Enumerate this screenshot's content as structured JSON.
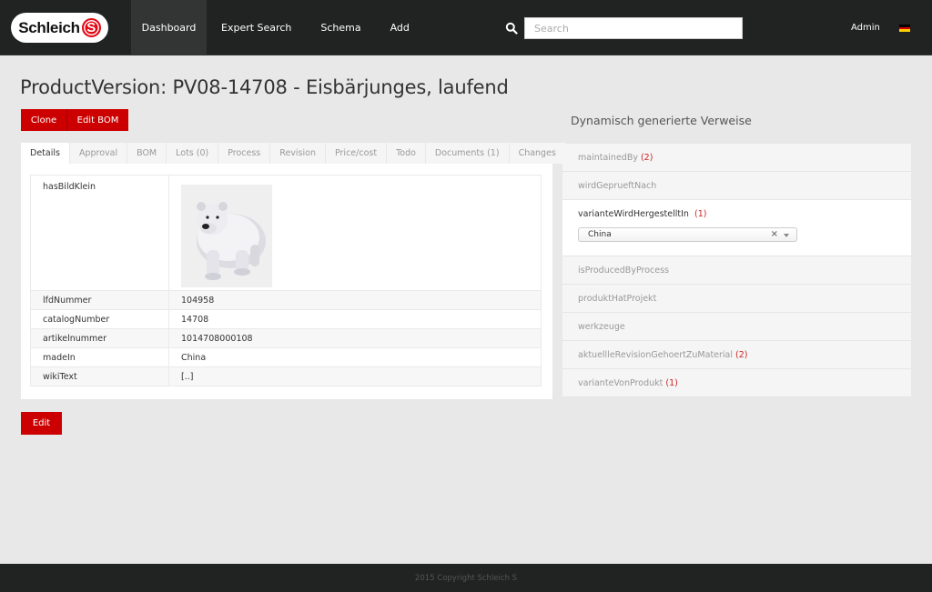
{
  "header": {
    "logo_text": "Schleich",
    "logo_mark": "S",
    "nav": [
      {
        "label": "Dashboard",
        "active": true
      },
      {
        "label": "Expert Search",
        "active": false
      },
      {
        "label": "Schema",
        "active": false
      },
      {
        "label": "Add",
        "active": false
      }
    ],
    "search": {
      "placeholder": "Search",
      "value": "",
      "icon": "search-icon"
    },
    "user": "Admin",
    "language_flag": "flag-de-icon",
    "flag_colors": [
      "#000000",
      "#dd0000",
      "#ffce00"
    ]
  },
  "page": {
    "title": "ProductVersion: PV08-14708 - Eisbärjunges, laufend",
    "actions": {
      "clone": "Clone",
      "edit_bom": "Edit BOM",
      "edit": "Edit"
    },
    "tabs": [
      {
        "label": "Details",
        "active": true
      },
      {
        "label": "Approval",
        "active": false
      },
      {
        "label": "BOM",
        "active": false
      },
      {
        "label": "Lots (0)",
        "active": false
      },
      {
        "label": "Process",
        "active": false
      },
      {
        "label": "Revision",
        "active": false
      },
      {
        "label": "Price/cost",
        "active": false
      },
      {
        "label": "Todo",
        "active": false
      },
      {
        "label": "Documents (1)",
        "active": false
      },
      {
        "label": "Changes",
        "active": false
      }
    ],
    "details": {
      "image_key": "hasBildKlein",
      "image_alt": "polar bear cub figure",
      "rows": [
        {
          "key": "lfdNummer",
          "value": "104958"
        },
        {
          "key": "catalogNumber",
          "value": "14708"
        },
        {
          "key": "artikelnummer",
          "value": "1014708000108"
        },
        {
          "key": "madeIn",
          "value": "China"
        },
        {
          "key": "wikiText",
          "value": "[..]"
        }
      ]
    }
  },
  "references": {
    "title": "Dynamisch generierte Verweise",
    "items": [
      {
        "label": "maintainedBy",
        "count": "(2)"
      },
      {
        "label": "wirdGeprueftNach",
        "count": ""
      },
      {
        "label": "varianteWirdHergestelltIn",
        "count": "(1)",
        "expanded": true,
        "selected": "China"
      },
      {
        "label": "isProducedByProcess",
        "count": ""
      },
      {
        "label": "produktHatProjekt",
        "count": ""
      },
      {
        "label": "werkzeuge",
        "count": ""
      },
      {
        "label": "aktuellleRevisionGehoertZuMaterial",
        "count": "(2)"
      },
      {
        "label": "varianteVonProdukt",
        "count": "(1)"
      }
    ]
  },
  "colors": {
    "accent": "#cc0000",
    "header_bg": "#212222",
    "count_red": "#cc2222"
  },
  "footer": {
    "text": "2015 Copyright Schleich S"
  }
}
